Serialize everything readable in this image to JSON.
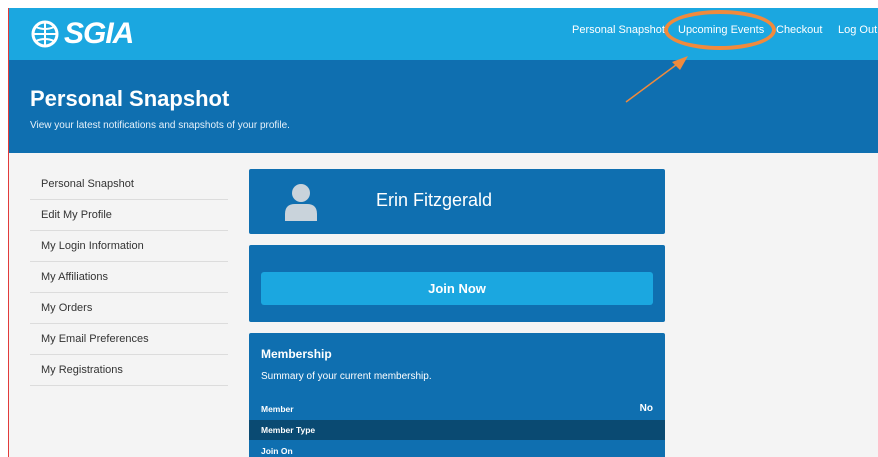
{
  "brand": {
    "logo_text": "SGIA"
  },
  "nav": {
    "personal_snapshot": "Personal Snapshot",
    "upcoming_events": "Upcoming Events",
    "checkout": "Checkout",
    "log_out": "Log Out"
  },
  "header": {
    "title": "Personal Snapshot",
    "subtitle": "View your latest notifications and snapshots of your profile."
  },
  "sidebar": {
    "items": [
      {
        "label": "Personal Snapshot"
      },
      {
        "label": "Edit My Profile"
      },
      {
        "label": "My Login Information"
      },
      {
        "label": "My Affiliations"
      },
      {
        "label": "My Orders"
      },
      {
        "label": "My Email Preferences"
      },
      {
        "label": "My Registrations"
      }
    ]
  },
  "profile": {
    "name": "Erin Fitzgerald"
  },
  "join": {
    "button_label": "Join Now"
  },
  "membership": {
    "title": "Membership",
    "subtitle": "Summary of your current membership.",
    "rows": [
      {
        "label": "Member",
        "value": "No"
      },
      {
        "label": "Member Type",
        "value": ""
      },
      {
        "label": "Join On",
        "value": ""
      }
    ]
  },
  "colors": {
    "topbar": "#1ba7e0",
    "banner": "#0f6fb0",
    "highlight": "#f08a3c",
    "content_bg": "#f4f4f4"
  }
}
